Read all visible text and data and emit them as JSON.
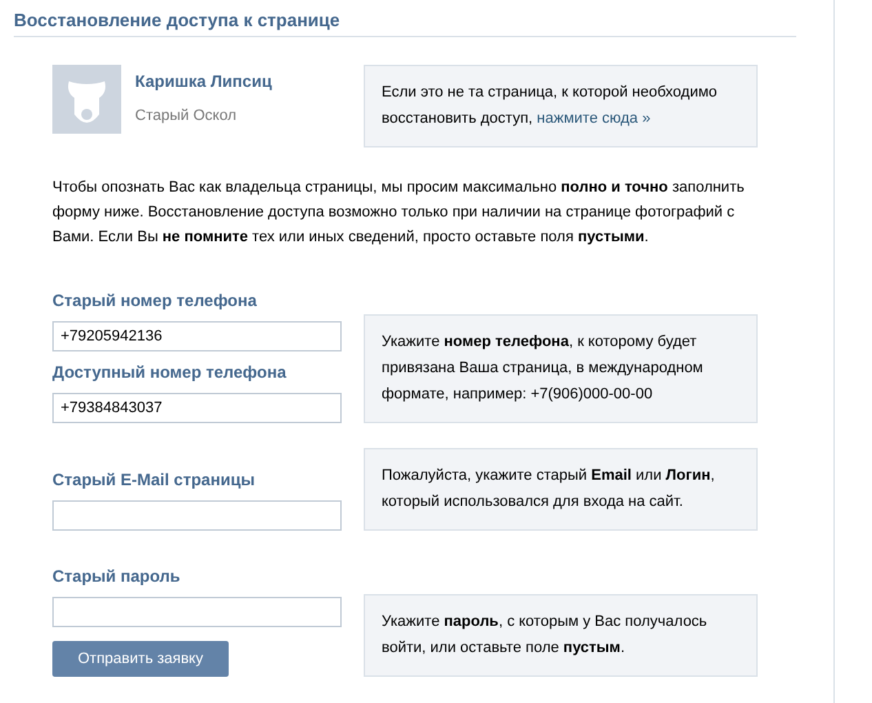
{
  "title": "Восстановление доступа к странице",
  "profile": {
    "name": "Каришка Липсиц",
    "city": "Старый Оскол",
    "notice": "Если это не та страница, к которой необходимо восстановить доступ, ",
    "notice_link": "нажмите сюда »"
  },
  "intro": "Чтобы опознать Вас как владельца страницы, мы просим максимально **полно и точно** заполнить форму ниже. Восстановление доступа возможно только при наличии на странице фотографий с Вами. Если Вы **не помните** тех или иных сведений, просто оставьте поля **пустыми**.",
  "sections": [
    {
      "fields": [
        {
          "label": "Старый номер телефона",
          "value": "+79205942136"
        },
        {
          "label": "Доступный номер телефона",
          "value": "+79384843037"
        }
      ],
      "hint": "Укажите **номер телефона**, к которому будет привязана Ваша страница, в международном формате, например: +7(906)000-00-00"
    },
    {
      "fields": [
        {
          "label": "Старый E-Mail страницы"
        }
      ],
      "hint": "Пожалуйста, укажите старый **Email** или **Логин**, который использовался для входа на сайт."
    },
    {
      "fields": [
        {
          "label": "Старый пароль"
        }
      ],
      "hint": "Укажите **пароль**, с которым у Вас получалось войти, или оставьте поле **пустым**.",
      "button": "Отправить заявку"
    }
  ]
}
